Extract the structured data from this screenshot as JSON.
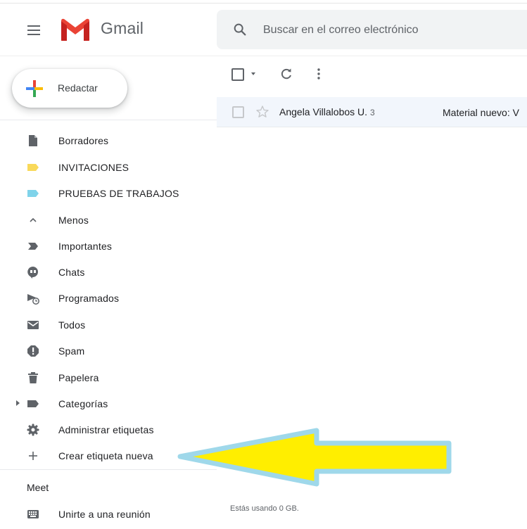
{
  "header": {
    "brand": "Gmail",
    "search_placeholder": "Buscar en el correo electrónico"
  },
  "compose": {
    "label": "Redactar"
  },
  "sidebar": {
    "items": [
      {
        "label": "Borradores",
        "icon": "draft-icon"
      },
      {
        "label": "INVITACIONES",
        "icon": "label-icon",
        "color": "#f9d95a"
      },
      {
        "label": "PRUEBAS DE TRABAJOS",
        "icon": "label-icon",
        "color": "#7fd3ea"
      },
      {
        "label": "Menos",
        "icon": "chevron-up-icon"
      },
      {
        "label": "Importantes",
        "icon": "important-icon"
      },
      {
        "label": "Chats",
        "icon": "chat-icon"
      },
      {
        "label": "Programados",
        "icon": "scheduled-icon"
      },
      {
        "label": "Todos",
        "icon": "mail-icon"
      },
      {
        "label": "Spam",
        "icon": "spam-icon"
      },
      {
        "label": "Papelera",
        "icon": "trash-icon"
      },
      {
        "label": "Categorías",
        "icon": "category-label-icon"
      },
      {
        "label": "Administrar etiquetas",
        "icon": "gear-icon"
      },
      {
        "label": "Crear etiqueta nueva",
        "icon": "plus-icon"
      }
    ],
    "meet_title": "Meet",
    "meet_items": [
      {
        "label": "Unirte a una reunión",
        "icon": "keyboard-icon"
      }
    ]
  },
  "email_list": {
    "rows": [
      {
        "sender": "Angela Villalobos U.",
        "count": "3",
        "subject": "Material nuevo: V"
      }
    ]
  },
  "footer": {
    "storage": "Estás usando 0 GB."
  },
  "annotation": {
    "arrow_fill": "#ffee00",
    "arrow_border": "#9fd8ea"
  }
}
